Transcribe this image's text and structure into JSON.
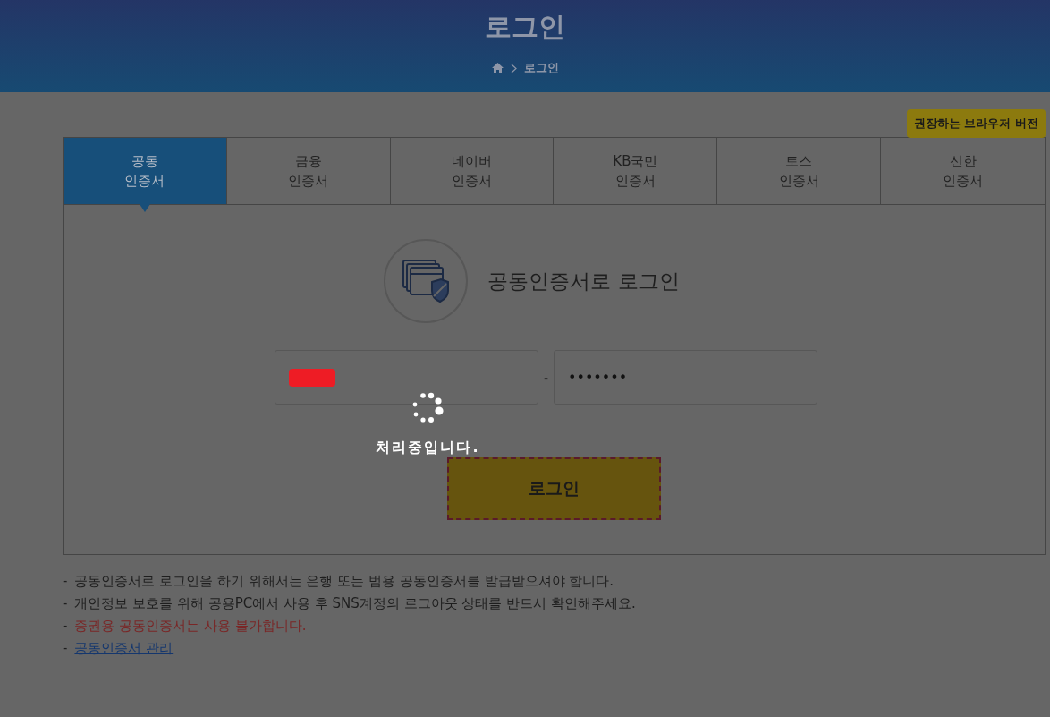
{
  "header": {
    "title": "로그인",
    "breadcrumb": [
      "로그인"
    ]
  },
  "browser_button": "권장하는 브라우저 버전",
  "tabs": [
    {
      "line1": "공동",
      "line2": "인증서",
      "selected": true
    },
    {
      "line1": "금융",
      "line2": "인증서",
      "selected": false
    },
    {
      "line1": "네이버",
      "line2": "인증서",
      "selected": false
    },
    {
      "line1": "KB국민",
      "line2": "인증서",
      "selected": false
    },
    {
      "line1": "토스",
      "line2": "인증서",
      "selected": false
    },
    {
      "line1": "신한",
      "line2": "인증서",
      "selected": false
    }
  ],
  "login": {
    "title": "공동인증서로 로그인",
    "id_redacted": true,
    "separator": "-",
    "password": "•••••••",
    "button": "로그인"
  },
  "loading": {
    "text": "처리중입니다."
  },
  "notes": [
    {
      "marker": "-",
      "text": "공동인증서로 로그인을 하기 위해서는 은행 또는 범용 공동인증서를 발급받으셔야 합니다.",
      "kind": "normal"
    },
    {
      "marker": "-",
      "text": "개인정보 보호를 위해 공용PC에서 사용 후 SNS계정의 로그아웃 상태를 반드시 확인해주세요.",
      "kind": "normal"
    },
    {
      "marker": "-",
      "text": "증권용 공동인증서는 사용 불가합니다.",
      "kind": "warning"
    },
    {
      "marker": "-",
      "text": "공동인증서 관리",
      "kind": "link"
    }
  ]
}
